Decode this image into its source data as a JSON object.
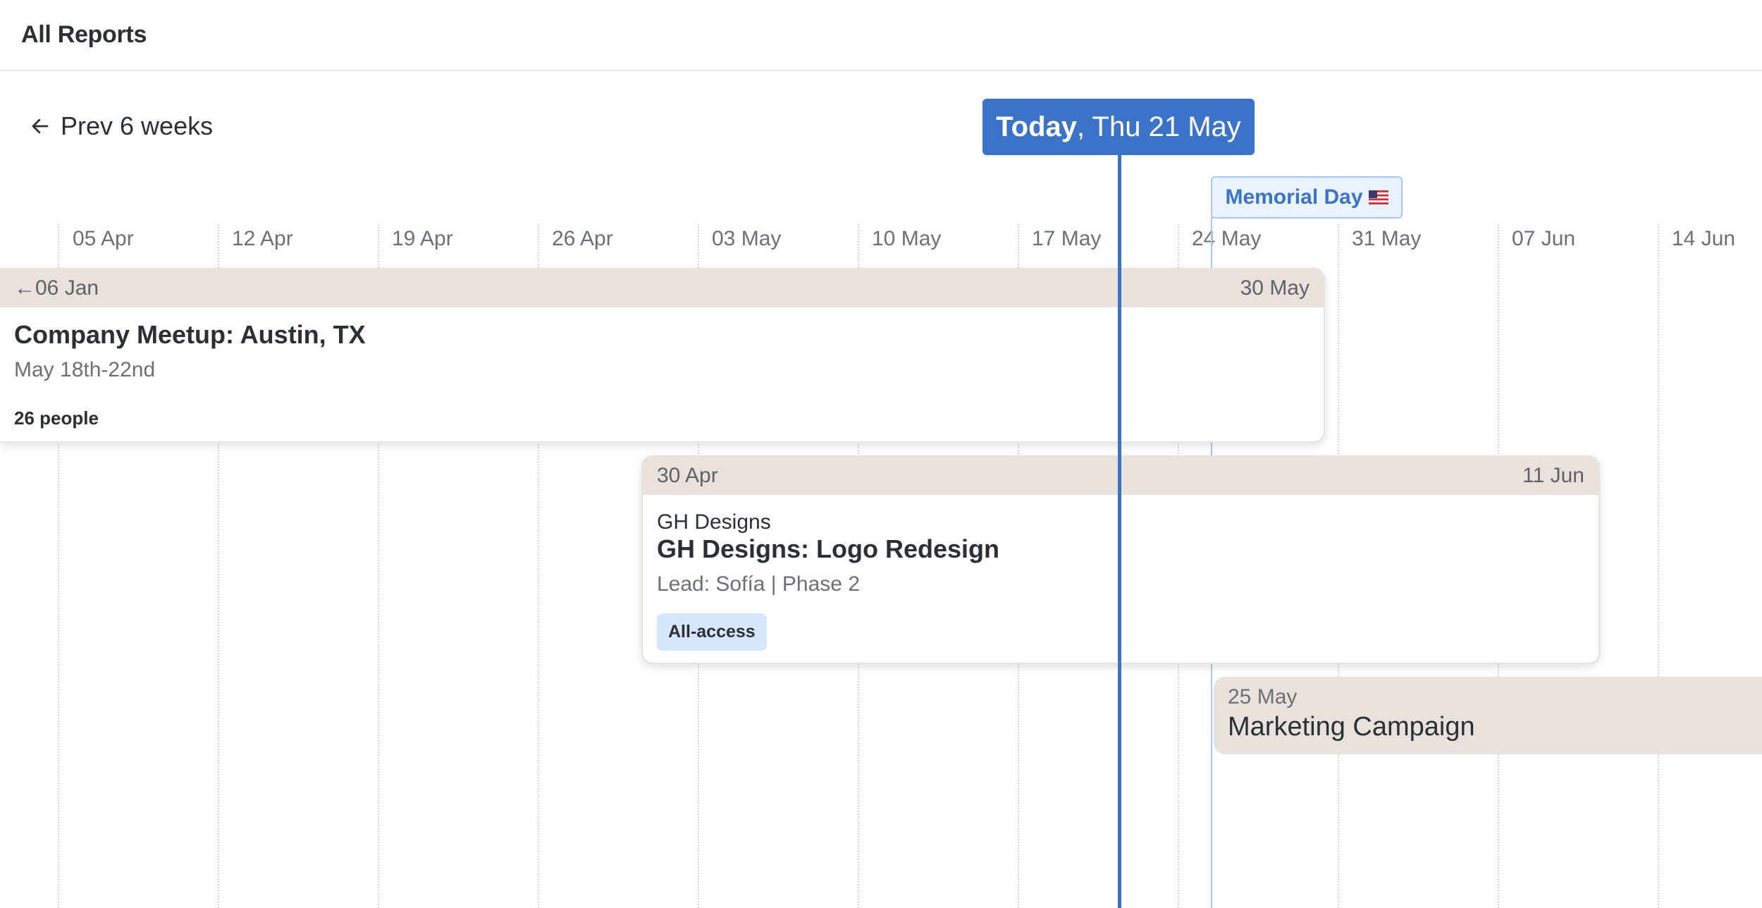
{
  "header": {
    "title": "All Reports"
  },
  "nav": {
    "prev_label": "Prev 6 weeks"
  },
  "today": {
    "strong": "Today",
    "rest": ", Thu 21 May"
  },
  "holiday": {
    "label": "Memorial Day"
  },
  "weeks": [
    "05 Apr",
    "12 Apr",
    "19 Apr",
    "26 Apr",
    "03 May",
    "10 May",
    "17 May",
    "24 May",
    "31 May",
    "07 Jun",
    "14 Jun"
  ],
  "events": [
    {
      "start": "06 Jan",
      "end": "30 May",
      "title": "Company Meetup: Austin, TX",
      "subtitle": "May 18th-22nd",
      "meta": "26 people"
    },
    {
      "start": "30 Apr",
      "end": "11 Jun",
      "client": "GH Designs",
      "title": "GH Designs: Logo Redesign",
      "subtitle": "Lead: Sofía | Phase 2",
      "tag": "All-access"
    },
    {
      "start": "25 May",
      "title": "Marketing Campaign"
    }
  ],
  "colors": {
    "accent": "#3a73c7",
    "holiday_bg": "#e9f2fd",
    "card_head": "#e8e1dc",
    "tag_bg": "#d6e6fb"
  }
}
